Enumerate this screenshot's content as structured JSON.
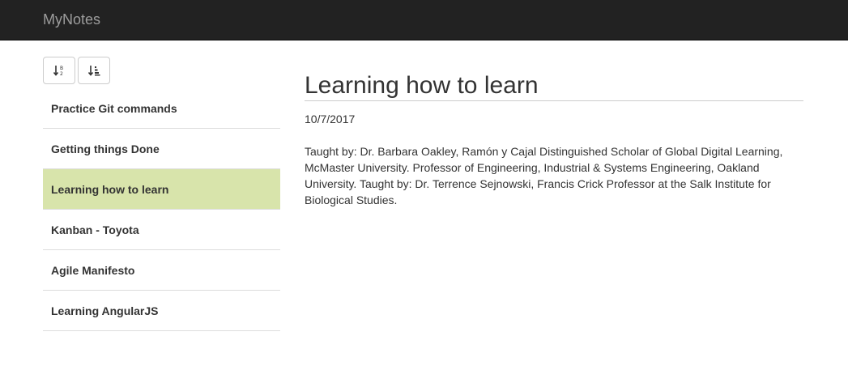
{
  "app": {
    "brand": "MyNotes"
  },
  "toolbar": {
    "sort_alpha_icon": "sort-alpha-icon",
    "sort_date_icon": "sort-amount-icon"
  },
  "notes": [
    {
      "title": "Practice Git commands",
      "active": false
    },
    {
      "title": "Getting things Done",
      "active": false
    },
    {
      "title": "Learning how to learn",
      "active": true
    },
    {
      "title": "Kanban - Toyota",
      "active": false
    },
    {
      "title": "Agile Manifesto",
      "active": false
    },
    {
      "title": "Learning AngularJS",
      "active": false
    }
  ],
  "detail": {
    "title": "Learning how to learn",
    "date": "10/7/2017",
    "body": "Taught by: Dr. Barbara Oakley, Ramón y Cajal Distinguished Scholar of Global Digital Learning, McMaster University. Professor of Engineering, Industrial & Systems Engineering, Oakland University. Taught by: Dr. Terrence Sejnowski, Francis Crick Professor at the Salk Institute for Biological Studies."
  },
  "colors": {
    "navbar": "#222222",
    "brand_text": "#9d9d9d",
    "active_item": "#d8e4ab"
  }
}
